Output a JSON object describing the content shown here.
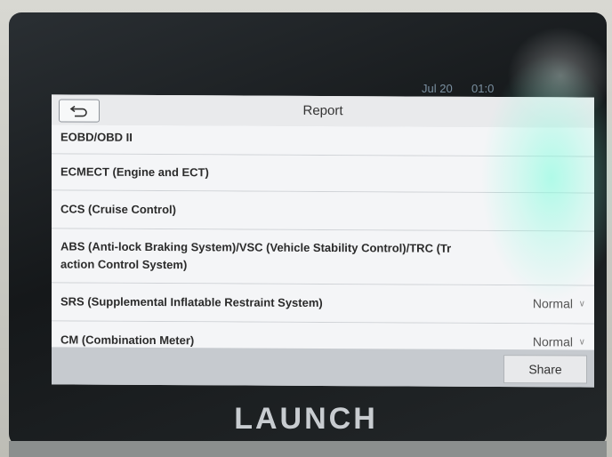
{
  "statusbar": {
    "date": "Jul 20",
    "time": "01:0"
  },
  "header": {
    "title": "Report"
  },
  "rows": [
    {
      "label": "EOBD/OBD II",
      "status": ""
    },
    {
      "label": "ECMECT (Engine and ECT)",
      "status": ""
    },
    {
      "label": "CCS (Cruise Control)",
      "status": ""
    },
    {
      "label_line1": "ABS (Anti-lock Braking System)/VSC (Vehicle Stability Control)/TRC (Tr",
      "label_line2": "action Control System)",
      "status": ""
    },
    {
      "label": "SRS (Supplemental Inflatable Restraint System)",
      "status": "Normal"
    },
    {
      "label": "CM (Combination Meter)",
      "status": "Normal"
    }
  ],
  "footer": {
    "share_label": "Share"
  },
  "device": {
    "brand": "LAUNCH"
  },
  "icons": {
    "back": "back-arrow-icon",
    "dropdown": "chevron-down-icon"
  }
}
